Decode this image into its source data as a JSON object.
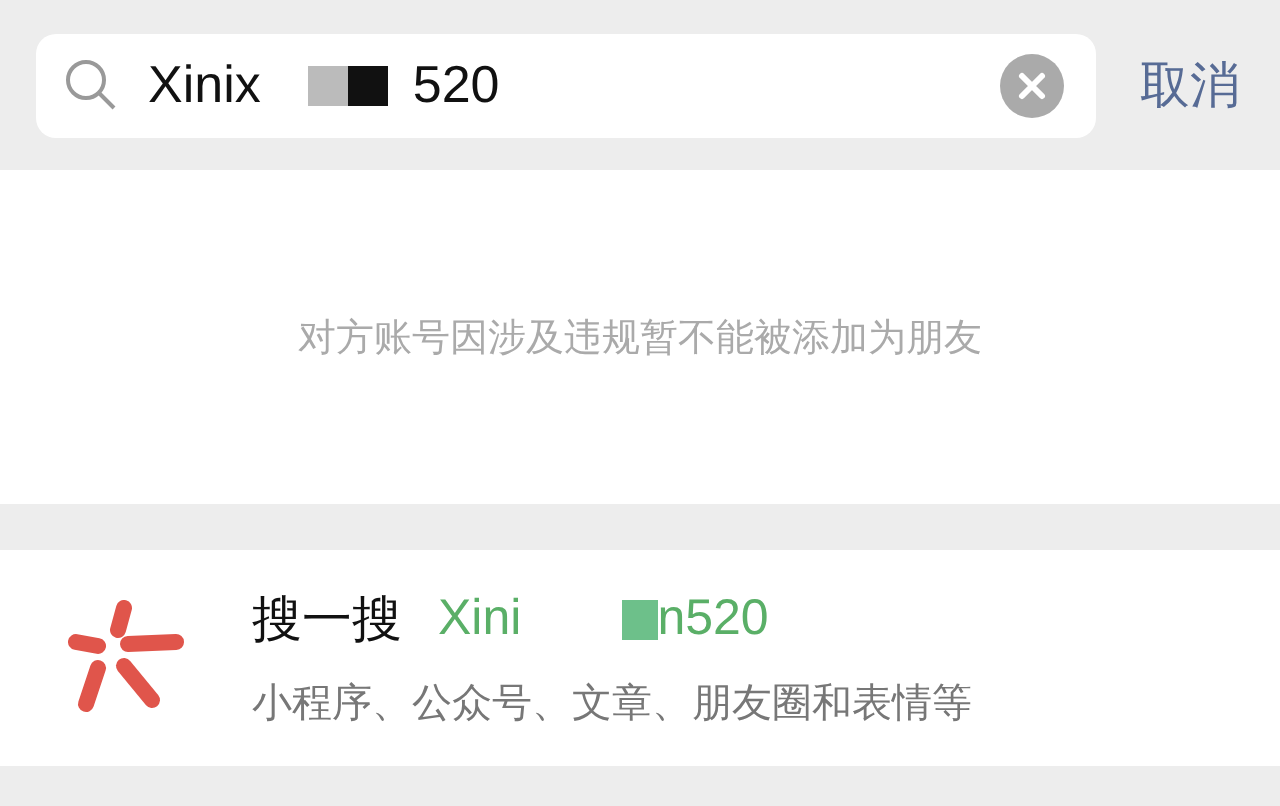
{
  "search": {
    "value_start": "Xinix",
    "value_end": "520"
  },
  "cancel_button": "取消",
  "notice": "对方账号因涉及违规暂不能被添加为朋友",
  "search_row": {
    "title": "搜一搜",
    "query_start": "Xini",
    "query_end": "n520",
    "subtitle": "小程序、公众号、文章、朋友圈和表情等"
  }
}
